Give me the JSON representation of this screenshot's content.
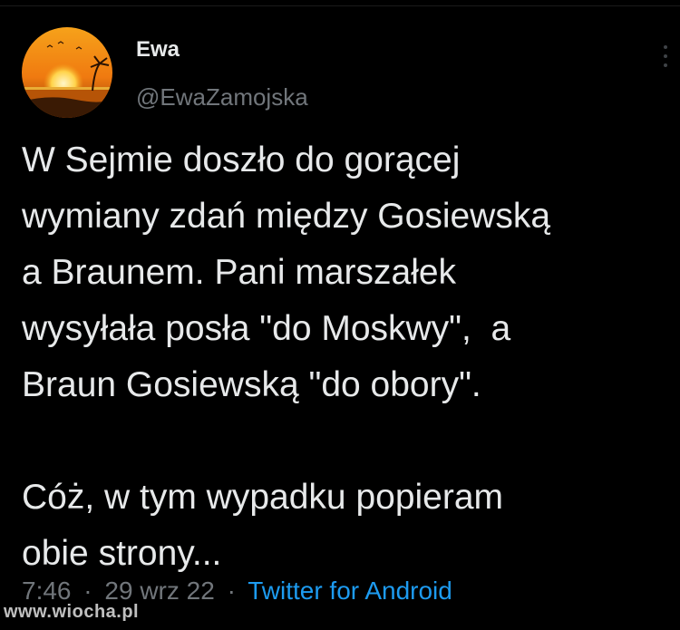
{
  "tweet": {
    "display_name": "Ewa",
    "handle": "@EwaZamojska",
    "text": "W Sejmie doszło do gorącej\nwymiany zdań między Gosiewską\na Braunem. Pani marszałek\nwysyłała posła \"do Moskwy\",  a\nBraun Gosiewską \"do obory\".\n\nCóż, w tym wypadku popieram\nobie strony...",
    "time": "7:46",
    "date": "29 wrz 22",
    "separator": "·",
    "source": "Twitter for Android"
  },
  "watermark": "www.wiocha.pl",
  "icons": {
    "avatar": "sunset-avatar",
    "more": "more-vertical-icon"
  },
  "colors": {
    "background": "#000000",
    "primary_text": "#e7e9ea",
    "secondary_text": "#71767b",
    "link": "#1d9bf0"
  }
}
